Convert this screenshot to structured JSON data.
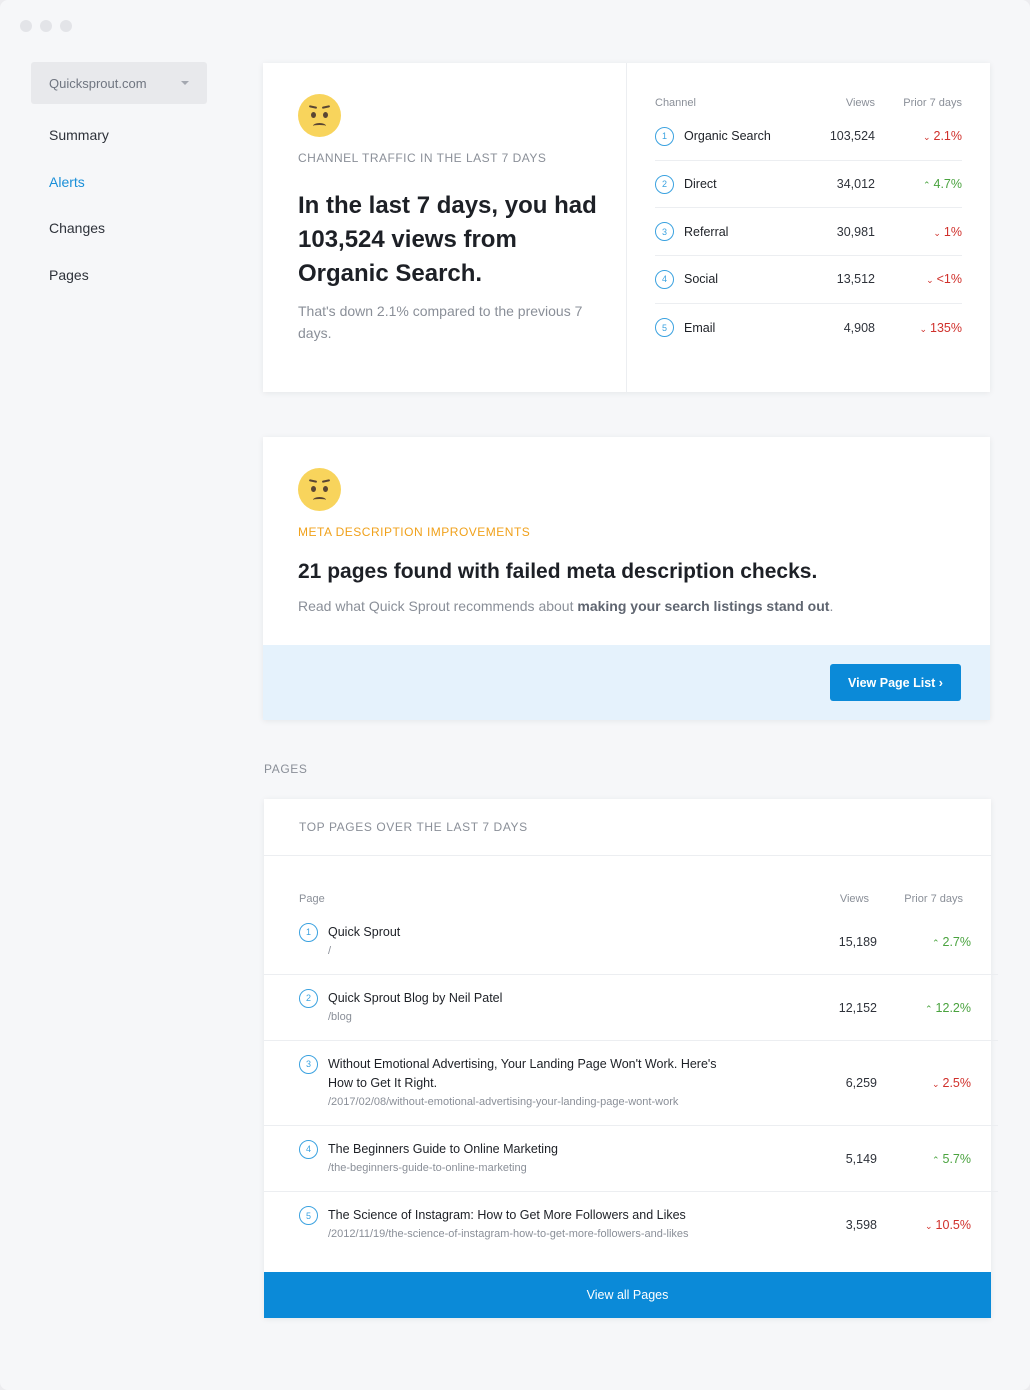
{
  "sidebar": {
    "site": "Quicksprout.com",
    "items": [
      {
        "label": "Summary"
      },
      {
        "label": "Alerts"
      },
      {
        "label": "Changes"
      },
      {
        "label": "Pages"
      }
    ]
  },
  "traffic": {
    "eyebrow": "CHANNEL TRAFFIC IN THE LAST 7 DAYS",
    "headline": "In the last 7 days, you had 103,524 views from Organic Search.",
    "subtext": "That's down 2.1% compared to the previous 7 days.",
    "columns": {
      "channel": "Channel",
      "views": "Views",
      "prior": "Prior 7 days"
    },
    "rows": [
      {
        "rank": "1",
        "name": "Organic Search",
        "views": "103,524",
        "change": "2.1%",
        "direction": "down"
      },
      {
        "rank": "2",
        "name": "Direct",
        "views": "34,012",
        "change": "4.7%",
        "direction": "up"
      },
      {
        "rank": "3",
        "name": "Referral",
        "views": "30,981",
        "change": "1%",
        "direction": "down"
      },
      {
        "rank": "4",
        "name": "Social",
        "views": "13,512",
        "change": "<1%",
        "direction": "down"
      },
      {
        "rank": "5",
        "name": "Email",
        "views": "4,908",
        "change": "135%",
        "direction": "down"
      }
    ]
  },
  "meta": {
    "eyebrow": "META DESCRIPTION IMPROVEMENTS",
    "headline": "21 pages found with failed meta description checks.",
    "subtext_prefix": "Read what Quick Sprout recommends about ",
    "subtext_link": "making your search listings stand out",
    "subtext_suffix": ".",
    "button": "View Page List ›"
  },
  "pages": {
    "section_label": "PAGES",
    "card_title": "TOP PAGES OVER THE LAST 7 DAYS",
    "columns": {
      "page": "Page",
      "views": "Views",
      "prior": "Prior 7 days"
    },
    "rows": [
      {
        "rank": "1",
        "title": "Quick Sprout",
        "path": "/",
        "views": "15,189",
        "change": "2.7%",
        "direction": "up"
      },
      {
        "rank": "2",
        "title": "Quick Sprout Blog by Neil Patel",
        "path": "/blog",
        "views": "12,152",
        "change": "12.2%",
        "direction": "up"
      },
      {
        "rank": "3",
        "title": "Without Emotional Advertising, Your Landing Page Won't Work. Here's How to Get It Right.",
        "path": "/2017/02/08/without-emotional-advertising-your-landing-page-wont-work",
        "views": "6,259",
        "change": "2.5%",
        "direction": "down"
      },
      {
        "rank": "4",
        "title": "The Beginners Guide to Online Marketing",
        "path": "/the-beginners-guide-to-online-marketing",
        "views": "5,149",
        "change": "5.7%",
        "direction": "up"
      },
      {
        "rank": "5",
        "title": "The Science of Instagram: How to Get More Followers and Likes",
        "path": "/2012/11/19/the-science-of-instagram-how-to-get-more-followers-and-likes",
        "views": "3,598",
        "change": "10.5%",
        "direction": "down"
      }
    ],
    "footer_button": "View all Pages"
  },
  "colors": {
    "accent": "#0b8ad8",
    "up": "#4aa33f",
    "down": "#d0302b",
    "meta_eyebrow": "#f0a11b"
  }
}
